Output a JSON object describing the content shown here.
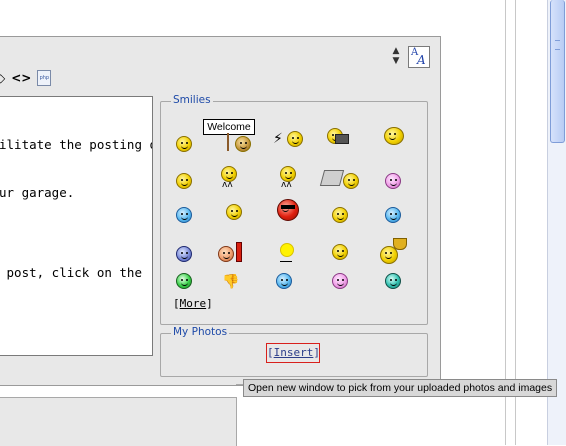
{
  "editor": {
    "lines": [
      "ilitate the posting of",
      "ur garage.",
      "",
      " post, click on the"
    ]
  },
  "toolbar": {
    "html_glyph": "<>",
    "php_label": "php",
    "font_button_label": "A"
  },
  "smilies": {
    "legend": "Smilies",
    "welcome_text": "Welcome",
    "more_link": "More"
  },
  "photos": {
    "legend": "My Photos",
    "insert_link": "Insert",
    "tooltip": "Open new window to pick from your uploaded photos and images"
  },
  "colors": {
    "legend_text": "#1e4aa8",
    "insert_border": "#d8201c",
    "panel_bg": "#e8e8e8"
  }
}
